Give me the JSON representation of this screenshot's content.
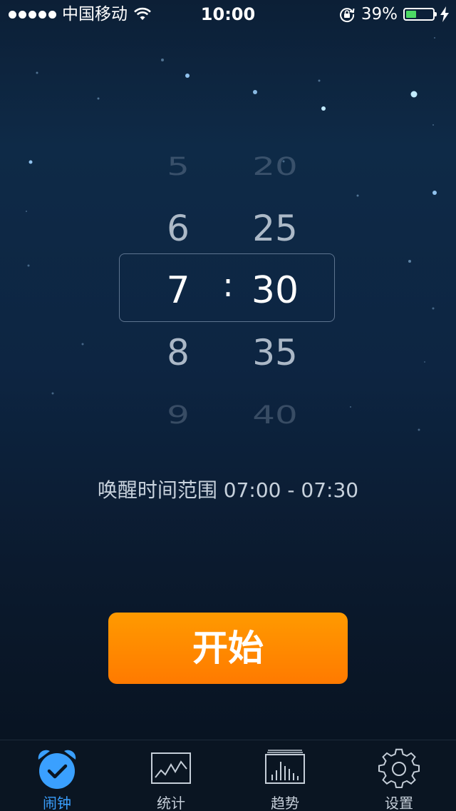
{
  "status_bar": {
    "carrier": "中国移动",
    "time": "10:00",
    "battery_percent": "39%",
    "battery_level": 0.39
  },
  "picker": {
    "hours": [
      "5",
      "6",
      "7",
      "8",
      "9"
    ],
    "minutes": [
      "20",
      "25",
      "30",
      "35",
      "40"
    ],
    "separator": ":",
    "selected_hour": "7",
    "selected_minute": "30"
  },
  "wake_range": "唤醒时间范围 07:00 - 07:30",
  "start_button_label": "开始",
  "tabs": [
    {
      "label": "闹钟",
      "icon": "alarm-clock-icon",
      "active": true
    },
    {
      "label": "统计",
      "icon": "line-chart-icon",
      "active": false
    },
    {
      "label": "趋势",
      "icon": "bar-chart-icon",
      "active": false
    },
    {
      "label": "设置",
      "icon": "gear-icon",
      "active": false
    }
  ],
  "colors": {
    "accent": "#3aa0ff",
    "button": "#ff8a00",
    "battery": "#4cd964"
  }
}
